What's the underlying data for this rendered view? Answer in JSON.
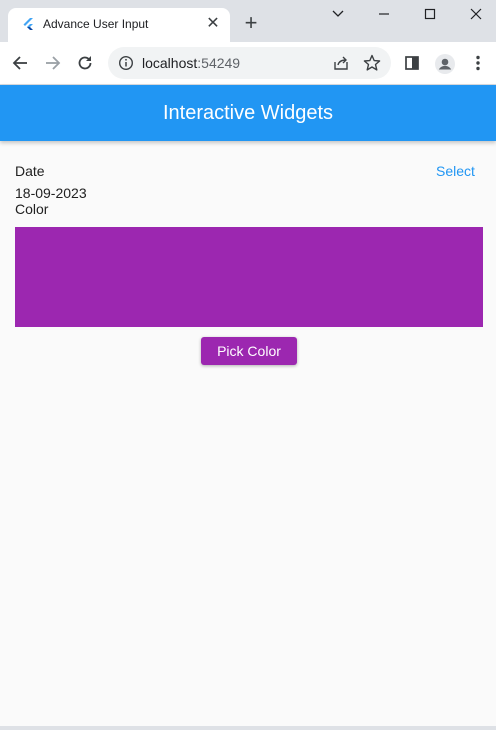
{
  "browser": {
    "tab_title": "Advance User Input",
    "url_host": "localhost",
    "url_port": ":54249"
  },
  "app": {
    "title": "Interactive Widgets",
    "date_label": "Date",
    "select_label": "Select",
    "date_value": "18-09-2023",
    "color_label": "Color",
    "pick_color_label": "Pick Color",
    "picked_color": "#9c27b0"
  },
  "colors": {
    "appbar": "#2196f3",
    "accent": "#2196f3",
    "swatch": "#9c27b0"
  }
}
